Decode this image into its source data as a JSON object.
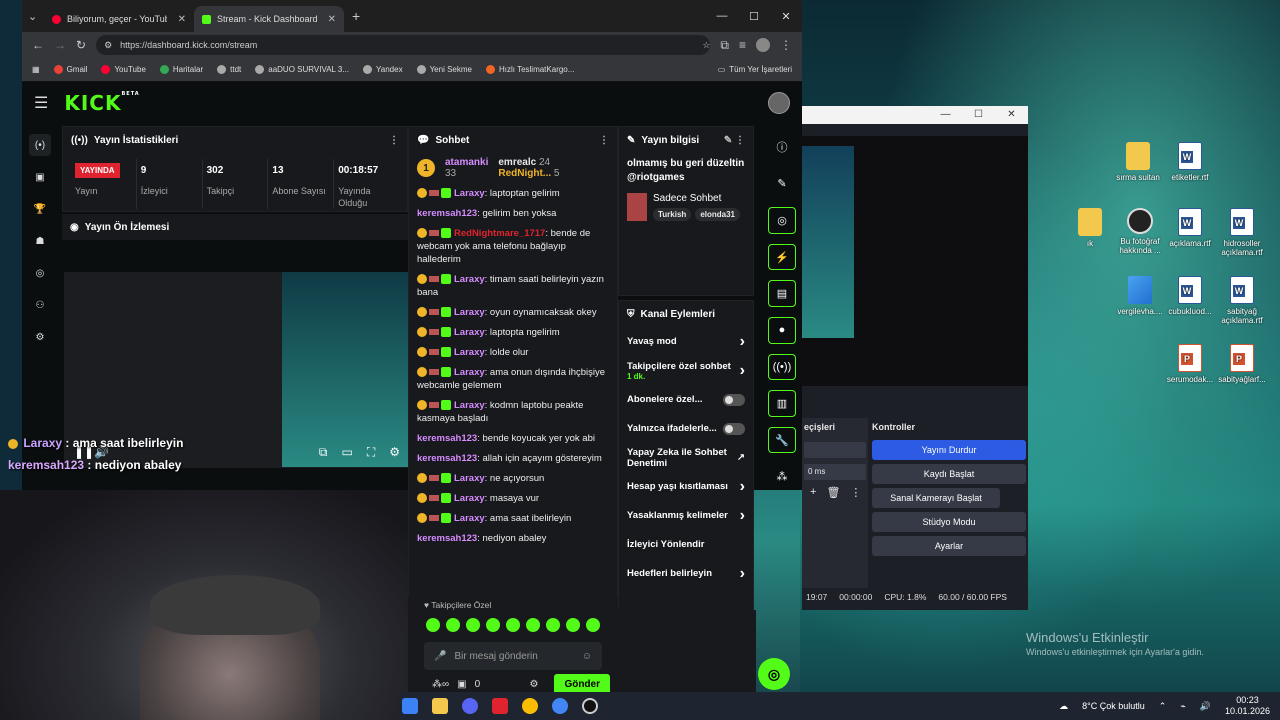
{
  "browser": {
    "tabs": [
      {
        "label": "Biliyorum, geçer - YouTube",
        "active": false
      },
      {
        "label": "Stream - Kick Dashboard",
        "active": true
      }
    ],
    "url": "https://dashboard.kick.com/stream",
    "bookmarks": [
      "Gmail",
      "YouTube",
      "Haritalar",
      "ttdt",
      "aaDUO SURVIVAL 3...",
      "Yandex",
      "Yeni Sekme",
      "Hızlı TeslimatKargo...",
      "Tüm Yer İşaretleri"
    ]
  },
  "kick": {
    "logo": "KICK",
    "logo_tag": "BETA",
    "stats_panel": {
      "title": "Yayın İstatistikleri",
      "live_label": "YAYINDA",
      "stream_label": "Yayın",
      "stats": [
        {
          "value": "9",
          "label": "İzleyici"
        },
        {
          "value": "302",
          "label": "Takipçi"
        },
        {
          "value": "13",
          "label": "Abone Sayısı"
        },
        {
          "value": "00:18:57",
          "label": "Yayında Olduğu"
        }
      ]
    },
    "preview_panel": {
      "title": "Yayın Ön İzlemesi"
    },
    "overlay_chat": [
      {
        "user": "Laraxy",
        "text": "ama saat ibelirleyin"
      },
      {
        "user": "keremsah123",
        "text": "nediyon abaley"
      }
    ],
    "chat": {
      "title": "Sohbet",
      "pinned": {
        "rank": "1",
        "user1": "atamanki",
        "count1": "33",
        "user2": "emrealc",
        "count2": "24",
        "user3": "RedNight...",
        "count3": "5"
      },
      "messages": [
        {
          "user": "Laraxy",
          "text": "laptoptan gelirim",
          "color": "#d58cff",
          "badges": true
        },
        {
          "user": "keremsah123",
          "text": "gelirim ben yoksa",
          "color": "#d58cff",
          "badges": false
        },
        {
          "user": "RedNightmare_1717",
          "text": "bende de webcam yok ama telefonu bağlayıp hallederim",
          "color": "#e0242f",
          "badges": true
        },
        {
          "user": "Laraxy",
          "text": "timam saati belirleyin yazın bana",
          "color": "#d58cff",
          "badges": true
        },
        {
          "user": "Laraxy",
          "text": "oyun oynamıcaksak okey",
          "color": "#d58cff",
          "badges": true
        },
        {
          "user": "Laraxy",
          "text": "laptopta ngelirim",
          "color": "#d58cff",
          "badges": true
        },
        {
          "user": "Laraxy",
          "text": "lolde olur",
          "color": "#d58cff",
          "badges": true
        },
        {
          "user": "Laraxy",
          "text": "ama onun dışında ihçbişiye webcamle gelemem",
          "color": "#d58cff",
          "badges": true
        },
        {
          "user": "Laraxy",
          "text": "kodmn laptobu peakte kasmaya başladı",
          "color": "#d58cff",
          "badges": true
        },
        {
          "user": "keremsah123",
          "text": "bende koyucak yer yok abi",
          "color": "#d58cff",
          "badges": false
        },
        {
          "user": "keremsah123",
          "text": "allah için açayım göstereyim",
          "color": "#d58cff",
          "badges": false
        },
        {
          "user": "Laraxy",
          "text": "ne açıyorsun",
          "color": "#d58cff",
          "badges": true
        },
        {
          "user": "Laraxy",
          "text": "masaya vur",
          "color": "#d58cff",
          "badges": true
        },
        {
          "user": "Laraxy",
          "text": "ama saat ibelirleyin",
          "color": "#d58cff",
          "badges": true
        },
        {
          "user": "keremsah123",
          "text": "nediyon abaley",
          "color": "#d58cff",
          "badges": false
        }
      ],
      "followers_label": "Takipçilere Özel",
      "input_placeholder": "Bir mesaj gönderin",
      "points": "0",
      "send_label": "Gönder"
    },
    "info": {
      "title": "Yayın bilgisi",
      "stream_title": "olmamış bu geri düzeltin @riotgames",
      "category": "Sadece Sohbet",
      "tags": [
        "Turkish",
        "elonda31"
      ]
    },
    "actions": {
      "title": "Kanal Eylemleri",
      "items": [
        {
          "label": "Yavaş mod",
          "type": "arrow",
          "sub": ""
        },
        {
          "label": "Takipçilere özel sohbet",
          "type": "arrow",
          "sub": "1 dk."
        },
        {
          "label": "Abonelere özel...",
          "type": "toggle",
          "sub": ""
        },
        {
          "label": "Yalnızca ifadelerle...",
          "type": "toggle",
          "sub": ""
        },
        {
          "label": "Yapay Zeka ile Sohbet Denetimi",
          "type": "ext",
          "sub": ""
        },
        {
          "label": "Hesap yaşı kısıtlaması",
          "type": "arrow",
          "sub": ""
        },
        {
          "label": "Yasaklanmış kelimeler",
          "type": "arrow",
          "sub": ""
        },
        {
          "label": "İzleyici Yönlendir",
          "type": "none",
          "sub": ""
        },
        {
          "label": "Hedefleri belirleyin",
          "type": "arrow",
          "sub": ""
        }
      ]
    }
  },
  "obs": {
    "controls_title": "Kontroller",
    "scenes_title": "eçişleri",
    "duration": "0 ms",
    "buttons": [
      "Yayını Durdur",
      "Kaydı Başlat",
      "Sanal Kamerayı Başlat",
      "Stüdyo Modu",
      "Ayarlar"
    ],
    "status": {
      "time": "19:07",
      "rec": "00:00:00",
      "cpu": "CPU: 1.8%",
      "fps": "60.00 / 60.00 FPS"
    }
  },
  "desktop": {
    "icons": [
      {
        "label": "sırma suitan",
        "type": "folder"
      },
      {
        "label": "etiketler.rtf",
        "type": "word"
      },
      {
        "label": "ık",
        "type": "folder"
      },
      {
        "label": "Bu fotoğraf hakkında ...",
        "type": "circ"
      },
      {
        "label": "açıklama.rtf",
        "type": "word"
      },
      {
        "label": "hidrosoller açıklama.rtf",
        "type": "word"
      },
      {
        "label": "vergilevha....",
        "type": "img"
      },
      {
        "label": "cubukluod...",
        "type": "word"
      },
      {
        "label": "sabityağ açıklama.rtf",
        "type": "word"
      },
      {
        "label": "serumodak...",
        "type": "ppt"
      },
      {
        "label": "sabityağlarf...",
        "type": "ppt"
      }
    ],
    "watermark_title": "Windows'u Etkinleştir",
    "watermark_sub": "Windows'u etkinleştirmek için Ayarlar'a gidin."
  },
  "taskbar": {
    "weather": "8°C  Çok bulutlu",
    "time": "00:23",
    "date": "10.01.2026"
  }
}
